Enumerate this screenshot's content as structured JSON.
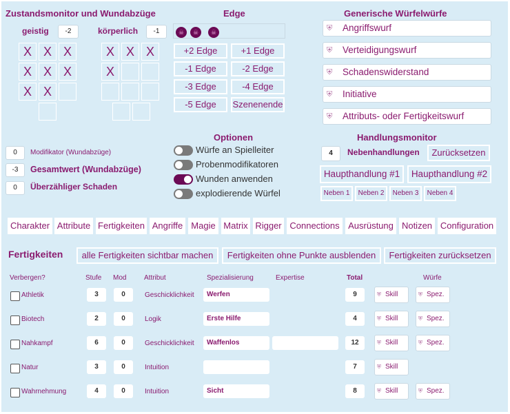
{
  "condition": {
    "title": "Zustandsmonitor und Wundabzüge",
    "stun_label": "geistig",
    "stun_value": "-2",
    "physical_label": "körperlich",
    "physical_value": "-1",
    "mark": "X"
  },
  "edge": {
    "title": "Edge",
    "icon": "skull-icon",
    "buttons": [
      "+2 Edge",
      "+1 Edge",
      "-1 Edge",
      "-2 Edge",
      "-3 Edge",
      "-4 Edge",
      "-5 Edge",
      "Szenenende"
    ]
  },
  "rolls": {
    "title": "Generische Würfelwürfe",
    "icon": "dice-icon",
    "items": [
      "Angriffswurf",
      "Verteidigungswurf",
      "Schadenswiderstand",
      "Initiative",
      "Attributs- oder Fertigkeitswurf"
    ]
  },
  "modifiers": {
    "wound_mod_value": "0",
    "wound_mod_label": "Modifikator (Wundabzüge)",
    "total_value": "-3",
    "total_label": "Gesamtwert (Wundabzüge)",
    "overflow_value": "0",
    "overflow_label": "Überzähliger Schaden"
  },
  "options": {
    "title": "Optionen",
    "items": [
      {
        "label": "Würfe an Spielleiter",
        "on": false
      },
      {
        "label": "Probenmodifikatoren",
        "on": false
      },
      {
        "label": "Wunden anwenden",
        "on": true
      },
      {
        "label": "explodierende Würfel",
        "on": false
      }
    ]
  },
  "actions": {
    "title": "Handlungsmonitor",
    "minor_count": "4",
    "minor_label": "Nebenhandlungen",
    "reset_label": "Zurücksetzen",
    "major1": "Haupthandlung #1",
    "major2": "Haupthandlung #2",
    "minors": [
      "Neben 1",
      "Neben 2",
      "Neben 3",
      "Neben 4"
    ]
  },
  "tabs": [
    "Charakter",
    "Attribute",
    "Fertigkeiten",
    "Angriffe",
    "Magie",
    "Matrix",
    "Rigger",
    "Connections",
    "Ausrüstung",
    "Notizen",
    "Configuration"
  ],
  "skills_section": {
    "title": "Fertigkeiten",
    "show_all": "alle Fertigkeiten sichtbar machen",
    "hide_zero": "Fertigkeiten ohne Punkte ausblenden",
    "reset": "Fertigkeiten zurücksetzen"
  },
  "skills_table": {
    "headers": {
      "hide": "Verbergen?",
      "rank": "Stufe",
      "mod": "Mod",
      "attr": "Attribut",
      "spec": "Spezialisierung",
      "expertise": "Expertise",
      "total": "Total",
      "rolls": "Würfe"
    },
    "skill_btn": "Skill",
    "spec_btn": "Spez.",
    "rows": [
      {
        "name": "Athletik",
        "rank": "3",
        "mod": "0",
        "attr": "Geschicklichkeit",
        "spec": "Werfen",
        "expertise": "",
        "total": "9"
      },
      {
        "name": "Biotech",
        "rank": "2",
        "mod": "0",
        "attr": "Logik",
        "spec": "Erste Hilfe",
        "expertise": "",
        "total": "4"
      },
      {
        "name": "Nahkampf",
        "rank": "6",
        "mod": "0",
        "attr": "Geschicklichkeit",
        "spec": "Waffenlos",
        "expertise": "",
        "total": "12"
      },
      {
        "name": "Natur",
        "rank": "3",
        "mod": "0",
        "attr": "Intuition",
        "spec": "",
        "expertise": "",
        "total": "7"
      },
      {
        "name": "Wahrnehmung",
        "rank": "4",
        "mod": "0",
        "attr": "Intuition",
        "spec": "Sicht",
        "expertise": "",
        "total": "8"
      }
    ]
  },
  "colors": {
    "accent": "#8a1b6f",
    "background": "#d9ecf6",
    "toggle_on": "#6b0a55"
  }
}
